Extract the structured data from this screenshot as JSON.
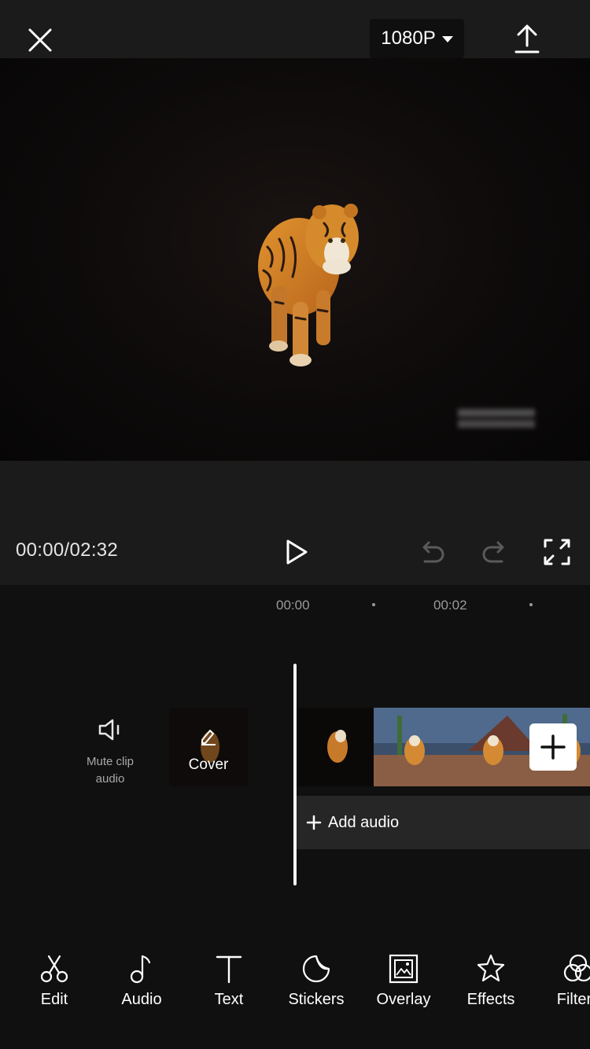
{
  "header": {
    "close_icon": "close-icon",
    "resolution": "1080P",
    "export_icon": "upload-icon"
  },
  "preview": {
    "subject": "tiger-image",
    "watermark": "blurred-watermark"
  },
  "playback": {
    "timecode": "00:00/02:32",
    "play_icon": "play-icon",
    "undo_icon": "undo-icon",
    "redo_icon": "redo-icon",
    "fullscreen_icon": "fullscreen-icon"
  },
  "timeline": {
    "ticks": [
      "00:00",
      "00:02"
    ],
    "mute_label": "Mute clip audio",
    "cover_label": "Cover",
    "add_audio_label": "Add audio"
  },
  "toolbar": {
    "items": [
      {
        "label": "Edit",
        "icon": "scissors-icon"
      },
      {
        "label": "Audio",
        "icon": "music-note-icon"
      },
      {
        "label": "Text",
        "icon": "text-icon"
      },
      {
        "label": "Stickers",
        "icon": "sticker-icon"
      },
      {
        "label": "Overlay",
        "icon": "overlay-icon"
      },
      {
        "label": "Effects",
        "icon": "star-effects-icon"
      },
      {
        "label": "Filters",
        "icon": "filters-icon"
      }
    ]
  },
  "colors": {
    "background": "#101010",
    "topbar": "#1b1b1b",
    "accent": "#ffffff"
  }
}
